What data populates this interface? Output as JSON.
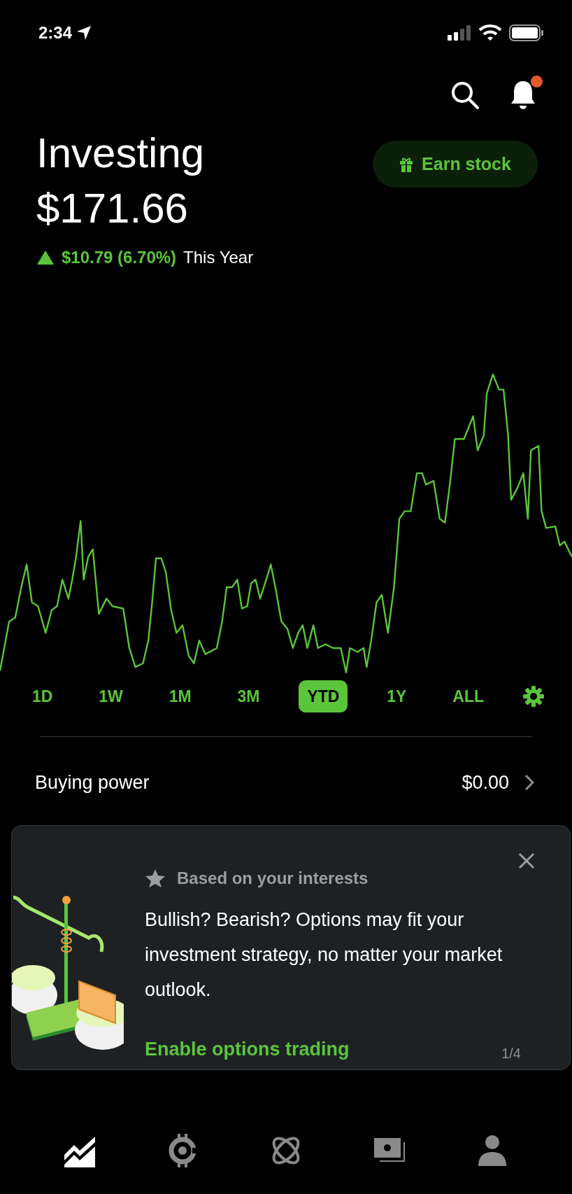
{
  "status_bar": {
    "time": "2:34"
  },
  "header": {
    "notification_dot": true,
    "title": "Investing",
    "value": "$171.66",
    "change": "$10.79 (6.70%)",
    "period": "This Year",
    "earn_button": "Earn stock"
  },
  "ranges": [
    {
      "label": "1D",
      "selected": false
    },
    {
      "label": "1W",
      "selected": false
    },
    {
      "label": "1M",
      "selected": false
    },
    {
      "label": "3M",
      "selected": false
    },
    {
      "label": "YTD",
      "selected": true
    },
    {
      "label": "1Y",
      "selected": false
    },
    {
      "label": "ALL",
      "selected": false
    }
  ],
  "buying_power": {
    "label": "Buying power",
    "value": "$0.00"
  },
  "card": {
    "tag": "Based on your interests",
    "body": "Bullish? Bearish? Options may fit your investment strategy, no matter your market outlook.",
    "action": "Enable options trading",
    "pager": "1/4"
  },
  "nav": [
    {
      "selected": true
    },
    {
      "selected": false
    },
    {
      "selected": false
    },
    {
      "selected": false
    },
    {
      "selected": false
    }
  ]
}
